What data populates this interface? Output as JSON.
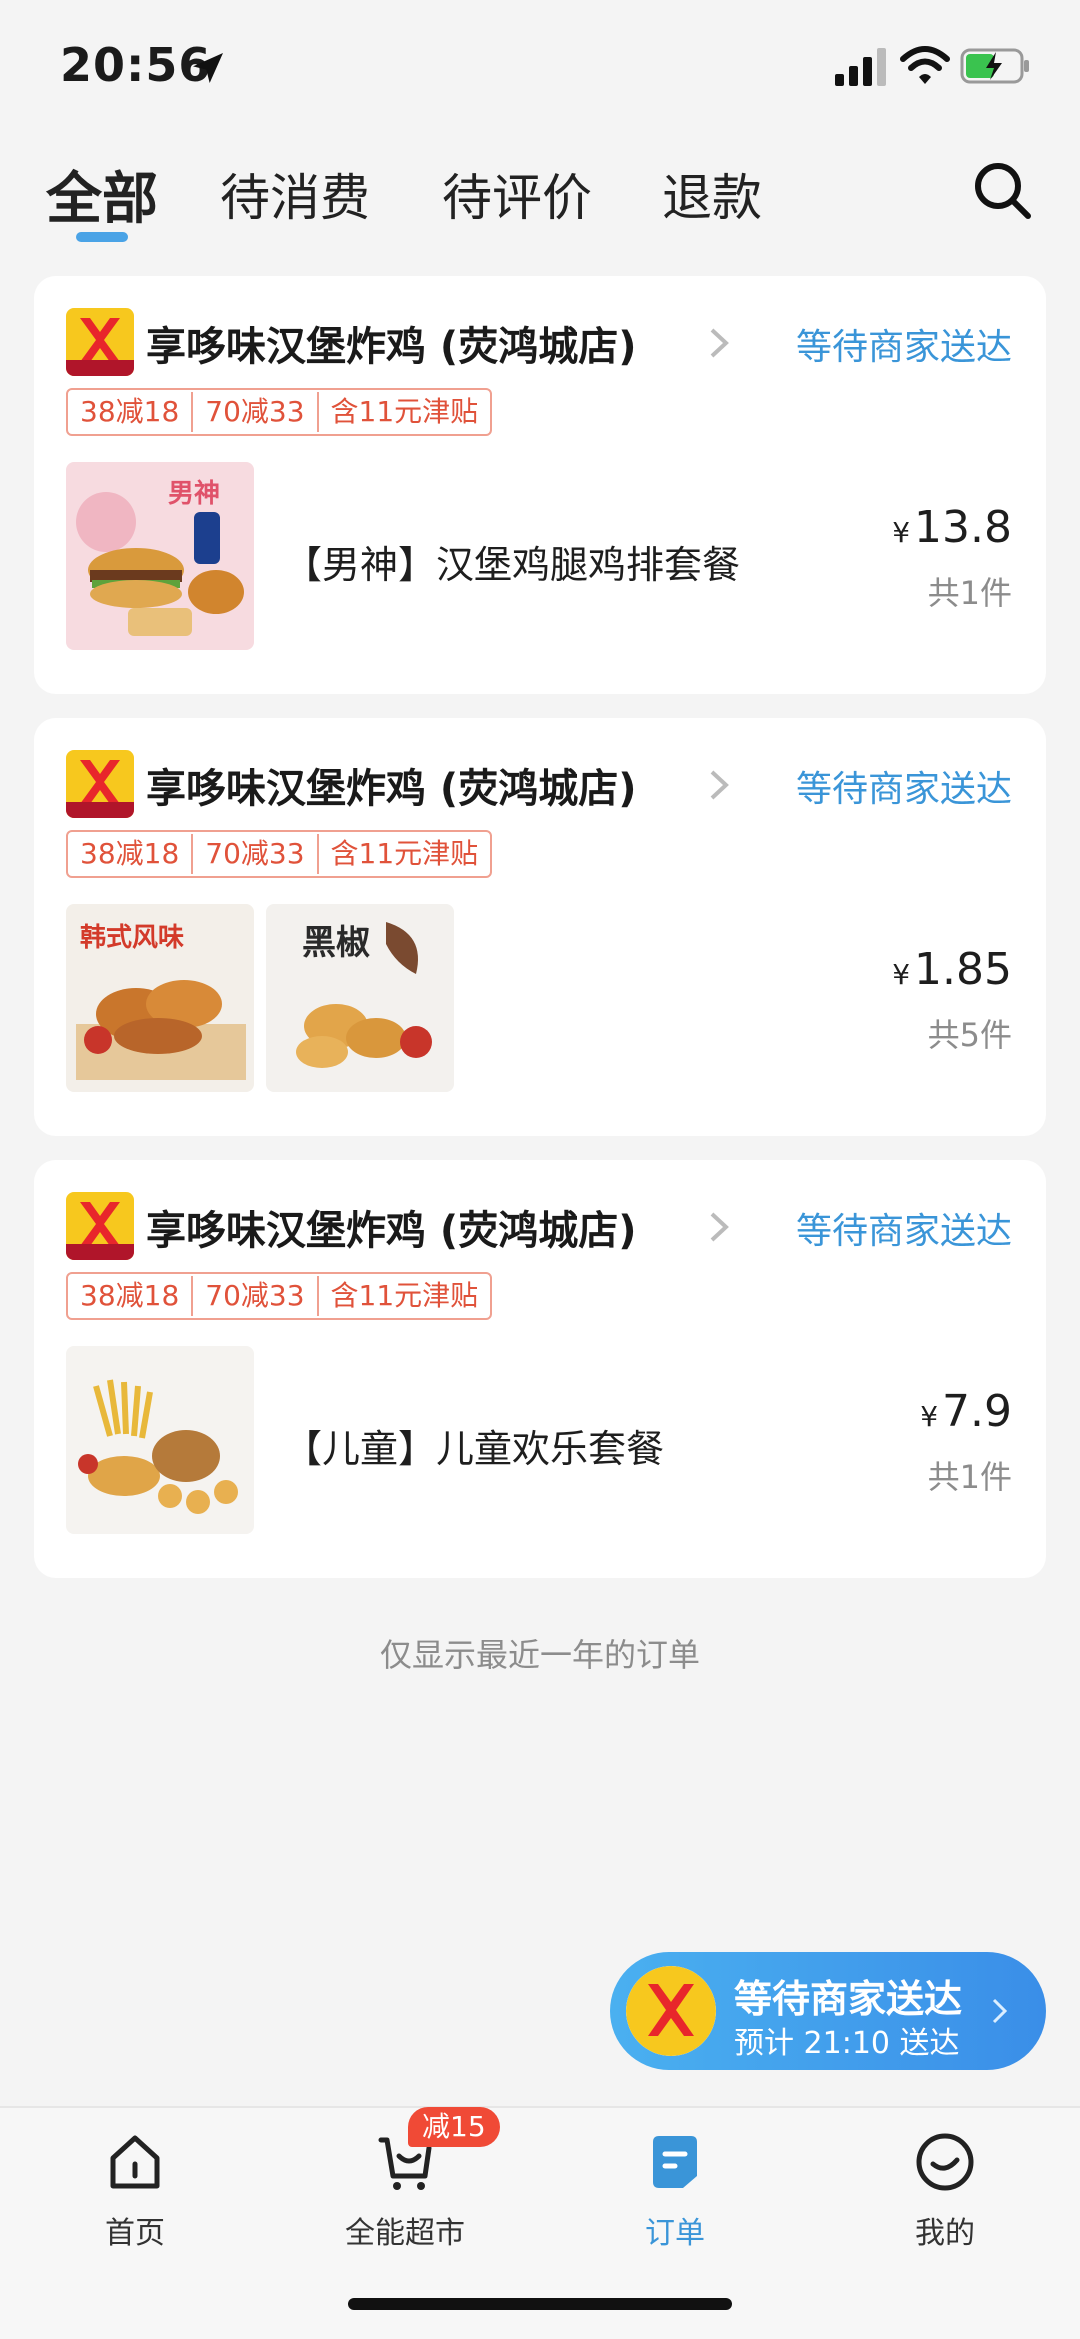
{
  "status_bar": {
    "time": "20:56"
  },
  "tabs": [
    {
      "label": "全部",
      "active": true
    },
    {
      "label": "待消费",
      "active": false
    },
    {
      "label": "待评价",
      "active": false
    },
    {
      "label": "退款",
      "active": false
    }
  ],
  "orders": [
    {
      "shop": "享哆味汉堡炸鸡 (荧鸿城店)",
      "status": "等待商家送达",
      "promos": [
        "38减18",
        "70减33",
        "含11元津贴"
      ],
      "item_name": "【男神】汉堡鸡腿鸡排套餐",
      "price": "13.8",
      "count": "共1件"
    },
    {
      "shop": "享哆味汉堡炸鸡 (荧鸿城店)",
      "status": "等待商家送达",
      "promos": [
        "38减18",
        "70减33",
        "含11元津贴"
      ],
      "item_name": "",
      "price": "1.85",
      "count": "共5件"
    },
    {
      "shop": "享哆味汉堡炸鸡 (荧鸿城店)",
      "status": "等待商家送达",
      "promos": [
        "38减18",
        "70减33",
        "含11元津贴"
      ],
      "item_name": "【儿童】儿童欢乐套餐",
      "price": "7.9",
      "count": "共1件"
    }
  ],
  "currency_symbol": "¥",
  "footnote": "仅显示最近一年的订单",
  "floating": {
    "title": "等待商家送达",
    "subtitle": "预计 21:10 送达"
  },
  "bottom_nav": [
    {
      "label": "首页",
      "icon": "home-icon"
    },
    {
      "label": "全能超市",
      "icon": "cart-icon"
    },
    {
      "label": "订单",
      "icon": "order-icon",
      "active": true
    },
    {
      "label": "我的",
      "icon": "profile-icon"
    }
  ],
  "badge": "减15",
  "colors": {
    "accent": "#3a95d8",
    "promo": "#e0523a",
    "badge": "#f04a36"
  }
}
